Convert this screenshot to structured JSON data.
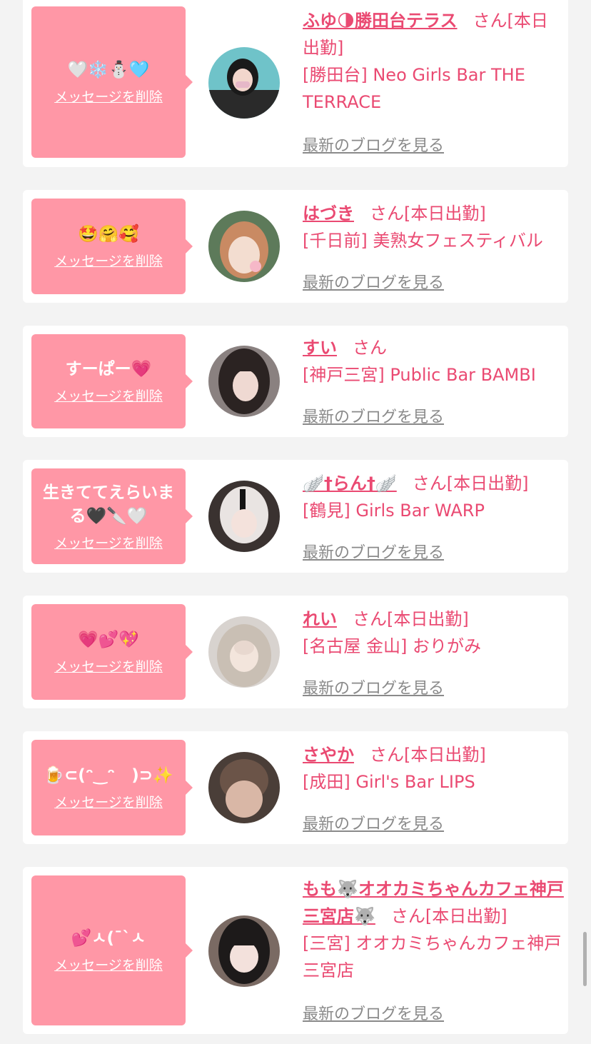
{
  "common": {
    "delete_label": "メッセージを削除",
    "blog_label": "最新のブログを見る",
    "san": "さん"
  },
  "colors": {
    "accent": "#ea4a72",
    "bubble": "#ff97a6",
    "background": "#f3f3f3",
    "link_gray": "#8a8a8a"
  },
  "items": [
    {
      "message": "🤍❄️⛄🩵",
      "name": "ふゆ🌗勝田台テラス",
      "status": "[本日出勤]",
      "shop": "[勝田台] Neo Girls Bar THE TERRACE"
    },
    {
      "message": "🤩🤗🥰",
      "name": "はづき",
      "status": "[本日出勤]",
      "shop": "[千日前] 美熟女フェスティバル"
    },
    {
      "message": "すーぱー💗",
      "name": "すい",
      "status": "",
      "shop": "[神戸三宮] Public Bar BAMBI"
    },
    {
      "message": "生きててえらいまる🖤🔪🤍",
      "name": "🪽†らん†🪽",
      "status": "[本日出勤]",
      "shop": "[鶴見] Girls Bar WARP"
    },
    {
      "message": "💗💕💖",
      "name": "れい",
      "status": "[本日出勤]",
      "shop": "[名古屋 金山] おりがみ"
    },
    {
      "message": "🍺⊂(ᵔ‿ᵔ　)⊃✨",
      "name": "さやか",
      "status": "[本日出勤]",
      "shop": "[成田] Girl's Bar LIPS"
    },
    {
      "message": "💕ㅅ(¯`ㅅ",
      "name": "もも🐺オオカミちゃんカフェ神戸三宮店🐺",
      "status": "[本日出勤]",
      "shop": "[三宮] オオカミちゃんカフェ神戸三宮店"
    }
  ]
}
